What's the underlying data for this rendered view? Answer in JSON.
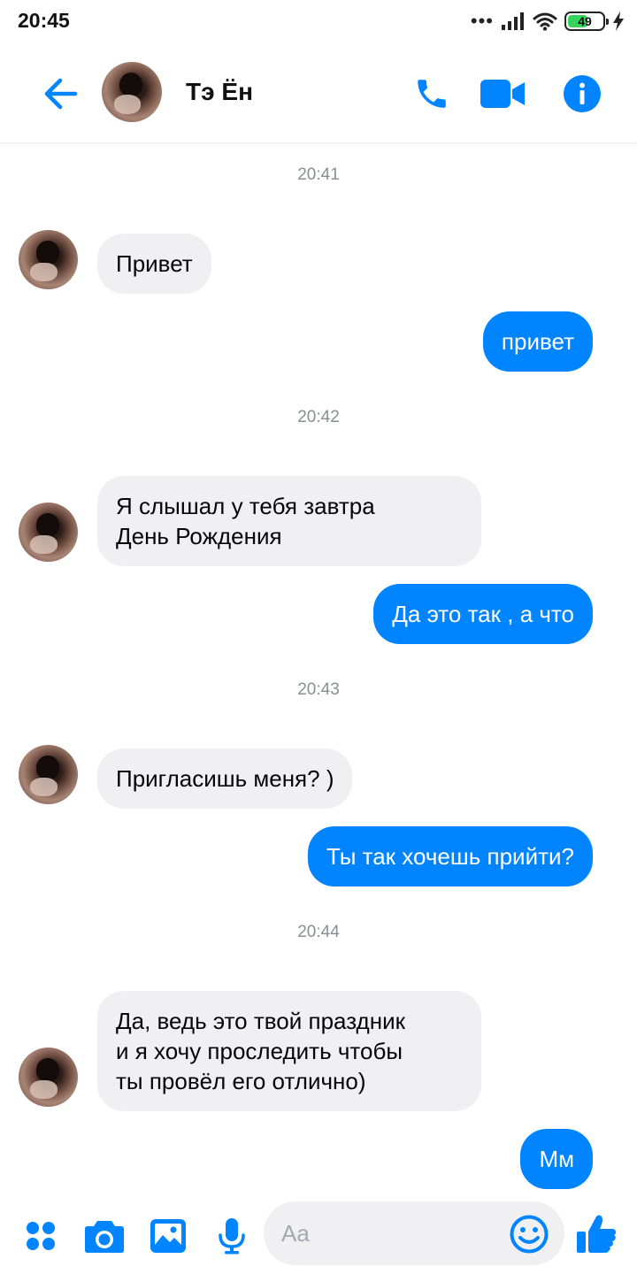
{
  "status_bar": {
    "time": "20:45",
    "signal_dots": "•••",
    "battery_level": "49"
  },
  "header": {
    "contact_name": "Тэ Ён",
    "accent_color": "#0084ff"
  },
  "timestamps": [
    "20:41",
    "20:42",
    "20:43",
    "20:44"
  ],
  "messages": [
    {
      "direction": "incoming",
      "text": "Привет"
    },
    {
      "direction": "outgoing",
      "text": "привет"
    },
    {
      "direction": "incoming",
      "lines": [
        "Я слышал у тебя завтра",
        "День Рождения"
      ]
    },
    {
      "direction": "outgoing",
      "text": "Да это так , а что"
    },
    {
      "direction": "incoming",
      "text": "Пригласишь меня? )"
    },
    {
      "direction": "outgoing",
      "text": "Ты так хочешь прийти?"
    },
    {
      "direction": "incoming",
      "lines": [
        "Да, ведь это твой праздник",
        "и я хочу проследить чтобы",
        "ты провёл его отлично)"
      ]
    },
    {
      "direction": "outgoing",
      "text": "Мм"
    }
  ],
  "composer": {
    "placeholder": "Aa",
    "icons": [
      "apps-icon",
      "camera-icon",
      "gallery-icon",
      "microphone-icon",
      "emoji-icon",
      "thumbs-up-icon"
    ]
  },
  "colors": {
    "outgoing_bubble": "#0084ff",
    "incoming_bubble": "#f0f0f3",
    "timestamp_text": "#8a8d91"
  }
}
